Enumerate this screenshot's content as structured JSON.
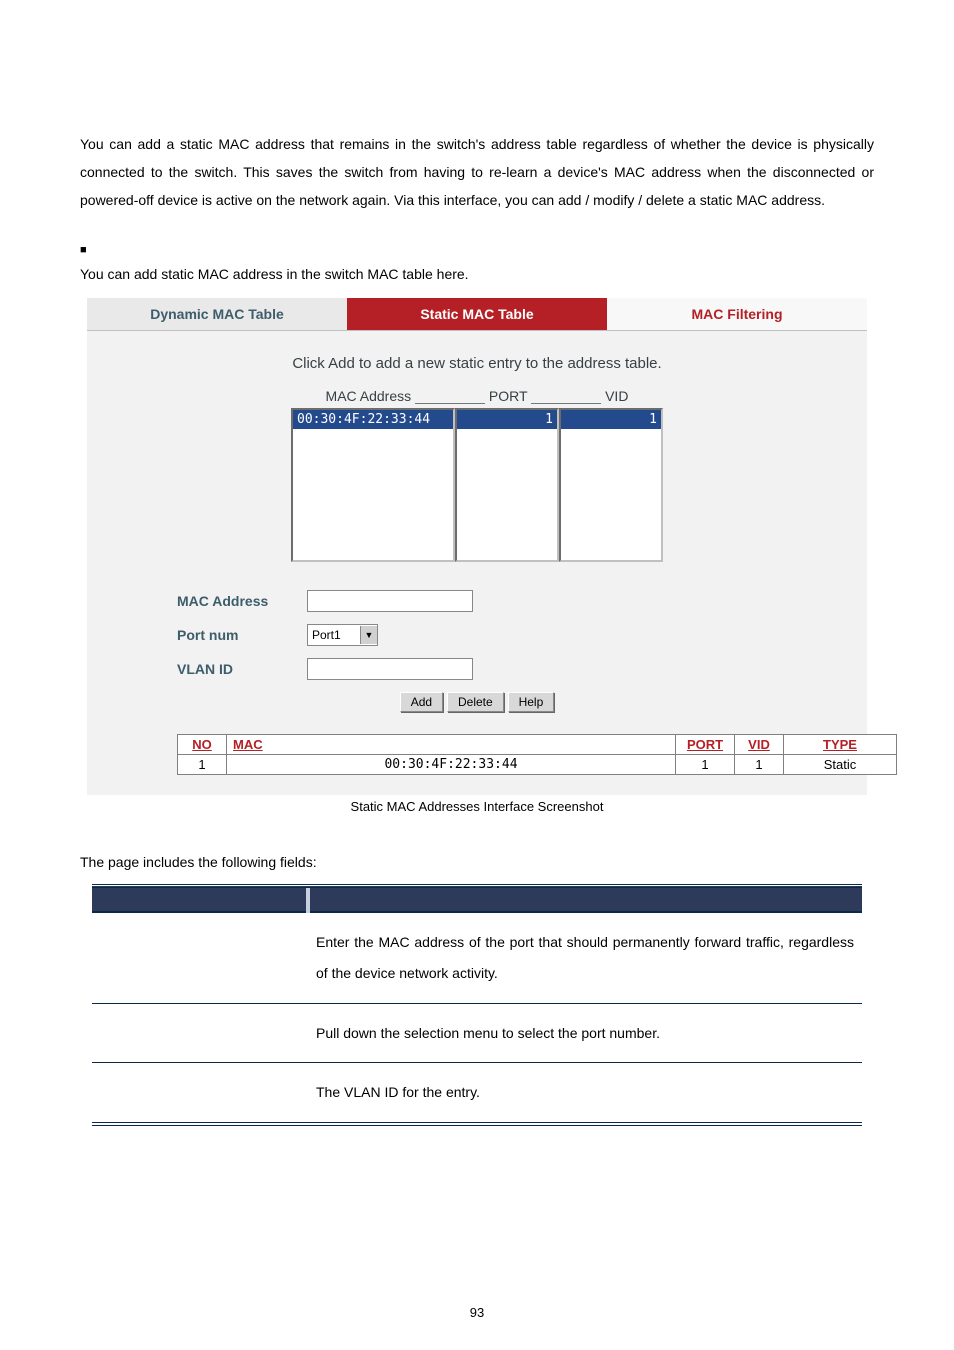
{
  "intro": "You can add a static MAC address that remains in the switch's address table regardless of whether the device is physically connected to the switch. This saves the switch from having to re-learn a device's MAC address when the disconnected or powered-off device is active on the network again. Via this interface, you can add / modify / delete a static MAC address.",
  "intro2": "You can add static MAC address in the switch MAC table here.",
  "bullet": "■",
  "tabs": {
    "dynamic": "Dynamic MAC Table",
    "static": "Static MAC Table",
    "filter": "MAC Filtering"
  },
  "panel": {
    "instruction": "Click Add to add a new static entry to the address table.",
    "head_mac": "MAC Address",
    "head_port": "PORT",
    "head_vid": "VID",
    "list": {
      "mac": "00:30:4F:22:33:44",
      "port": "1",
      "vid": "1"
    },
    "form": {
      "mac_label": "MAC Address",
      "port_label": "Port num",
      "vlan_label": "VLAN ID",
      "port_value": "Port1"
    },
    "buttons": {
      "add": "Add",
      "delete": "Delete",
      "help": "Help"
    }
  },
  "result": {
    "headers": {
      "no": "NO",
      "mac": "MAC",
      "port": "PORT",
      "vid": "VID",
      "type": "TYPE"
    },
    "row": {
      "no": "1",
      "mac": "00:30:4F:22:33:44",
      "port": "1",
      "vid": "1",
      "type": "Static"
    }
  },
  "caption": "Static MAC Addresses Interface Screenshot",
  "fields_intro": "The page includes the following fields:",
  "fields": {
    "mac": "Enter the MAC address of the port that should permanently forward traffic, regardless of the device network activity.",
    "port": "Pull down the selection menu to select the port number.",
    "vlan": "The VLAN ID for the entry."
  },
  "page_number": "93"
}
